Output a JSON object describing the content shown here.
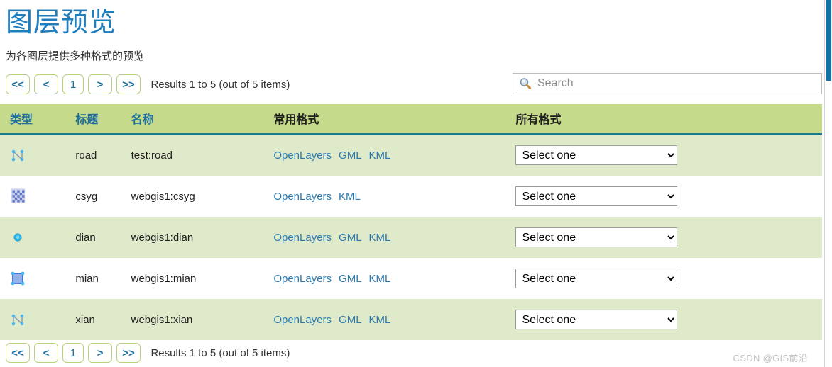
{
  "page": {
    "title": "图层预览",
    "subtitle": "为各图层提供多种格式的预览",
    "watermark": "CSDN @GIS前沿",
    "accent_color": "#1f7fbe",
    "header_bg": "#c5da8b",
    "row_alt_bg": "#dfeacb",
    "link_color": "#2a7ab0"
  },
  "pager": {
    "first_label": "<<",
    "prev_label": "<",
    "page_label": "1",
    "next_label": ">",
    "last_label": ">>",
    "status": "Results 1 to 5 (out of 5 items)"
  },
  "search": {
    "value": "",
    "placeholder": "Search",
    "icon": "search-icon"
  },
  "table": {
    "columns": [
      {
        "key": "type",
        "label": "类型",
        "sorted": true
      },
      {
        "key": "title",
        "label": "标题",
        "sorted": true
      },
      {
        "key": "name",
        "label": "名称",
        "sorted": true
      },
      {
        "key": "common",
        "label": "常用格式",
        "sorted": false
      },
      {
        "key": "all",
        "label": "所有格式",
        "sorted": false
      }
    ],
    "select_placeholder": "Select one",
    "rows": [
      {
        "icon": "line-geometry-icon",
        "title": "road",
        "name": "test:road",
        "common_formats": [
          "OpenLayers",
          "GML",
          "KML"
        ],
        "all_formats_selected": "Select one"
      },
      {
        "icon": "raster-geometry-icon",
        "title": "csyg",
        "name": "webgis1:csyg",
        "common_formats": [
          "OpenLayers",
          "KML"
        ],
        "all_formats_selected": "Select one"
      },
      {
        "icon": "point-geometry-icon",
        "title": "dian",
        "name": "webgis1:dian",
        "common_formats": [
          "OpenLayers",
          "GML",
          "KML"
        ],
        "all_formats_selected": "Select one"
      },
      {
        "icon": "polygon-geometry-icon",
        "title": "mian",
        "name": "webgis1:mian",
        "common_formats": [
          "OpenLayers",
          "GML",
          "KML"
        ],
        "all_formats_selected": "Select one"
      },
      {
        "icon": "line-geometry-icon",
        "title": "xian",
        "name": "webgis1:xian",
        "common_formats": [
          "OpenLayers",
          "GML",
          "KML"
        ],
        "all_formats_selected": "Select one"
      }
    ]
  }
}
